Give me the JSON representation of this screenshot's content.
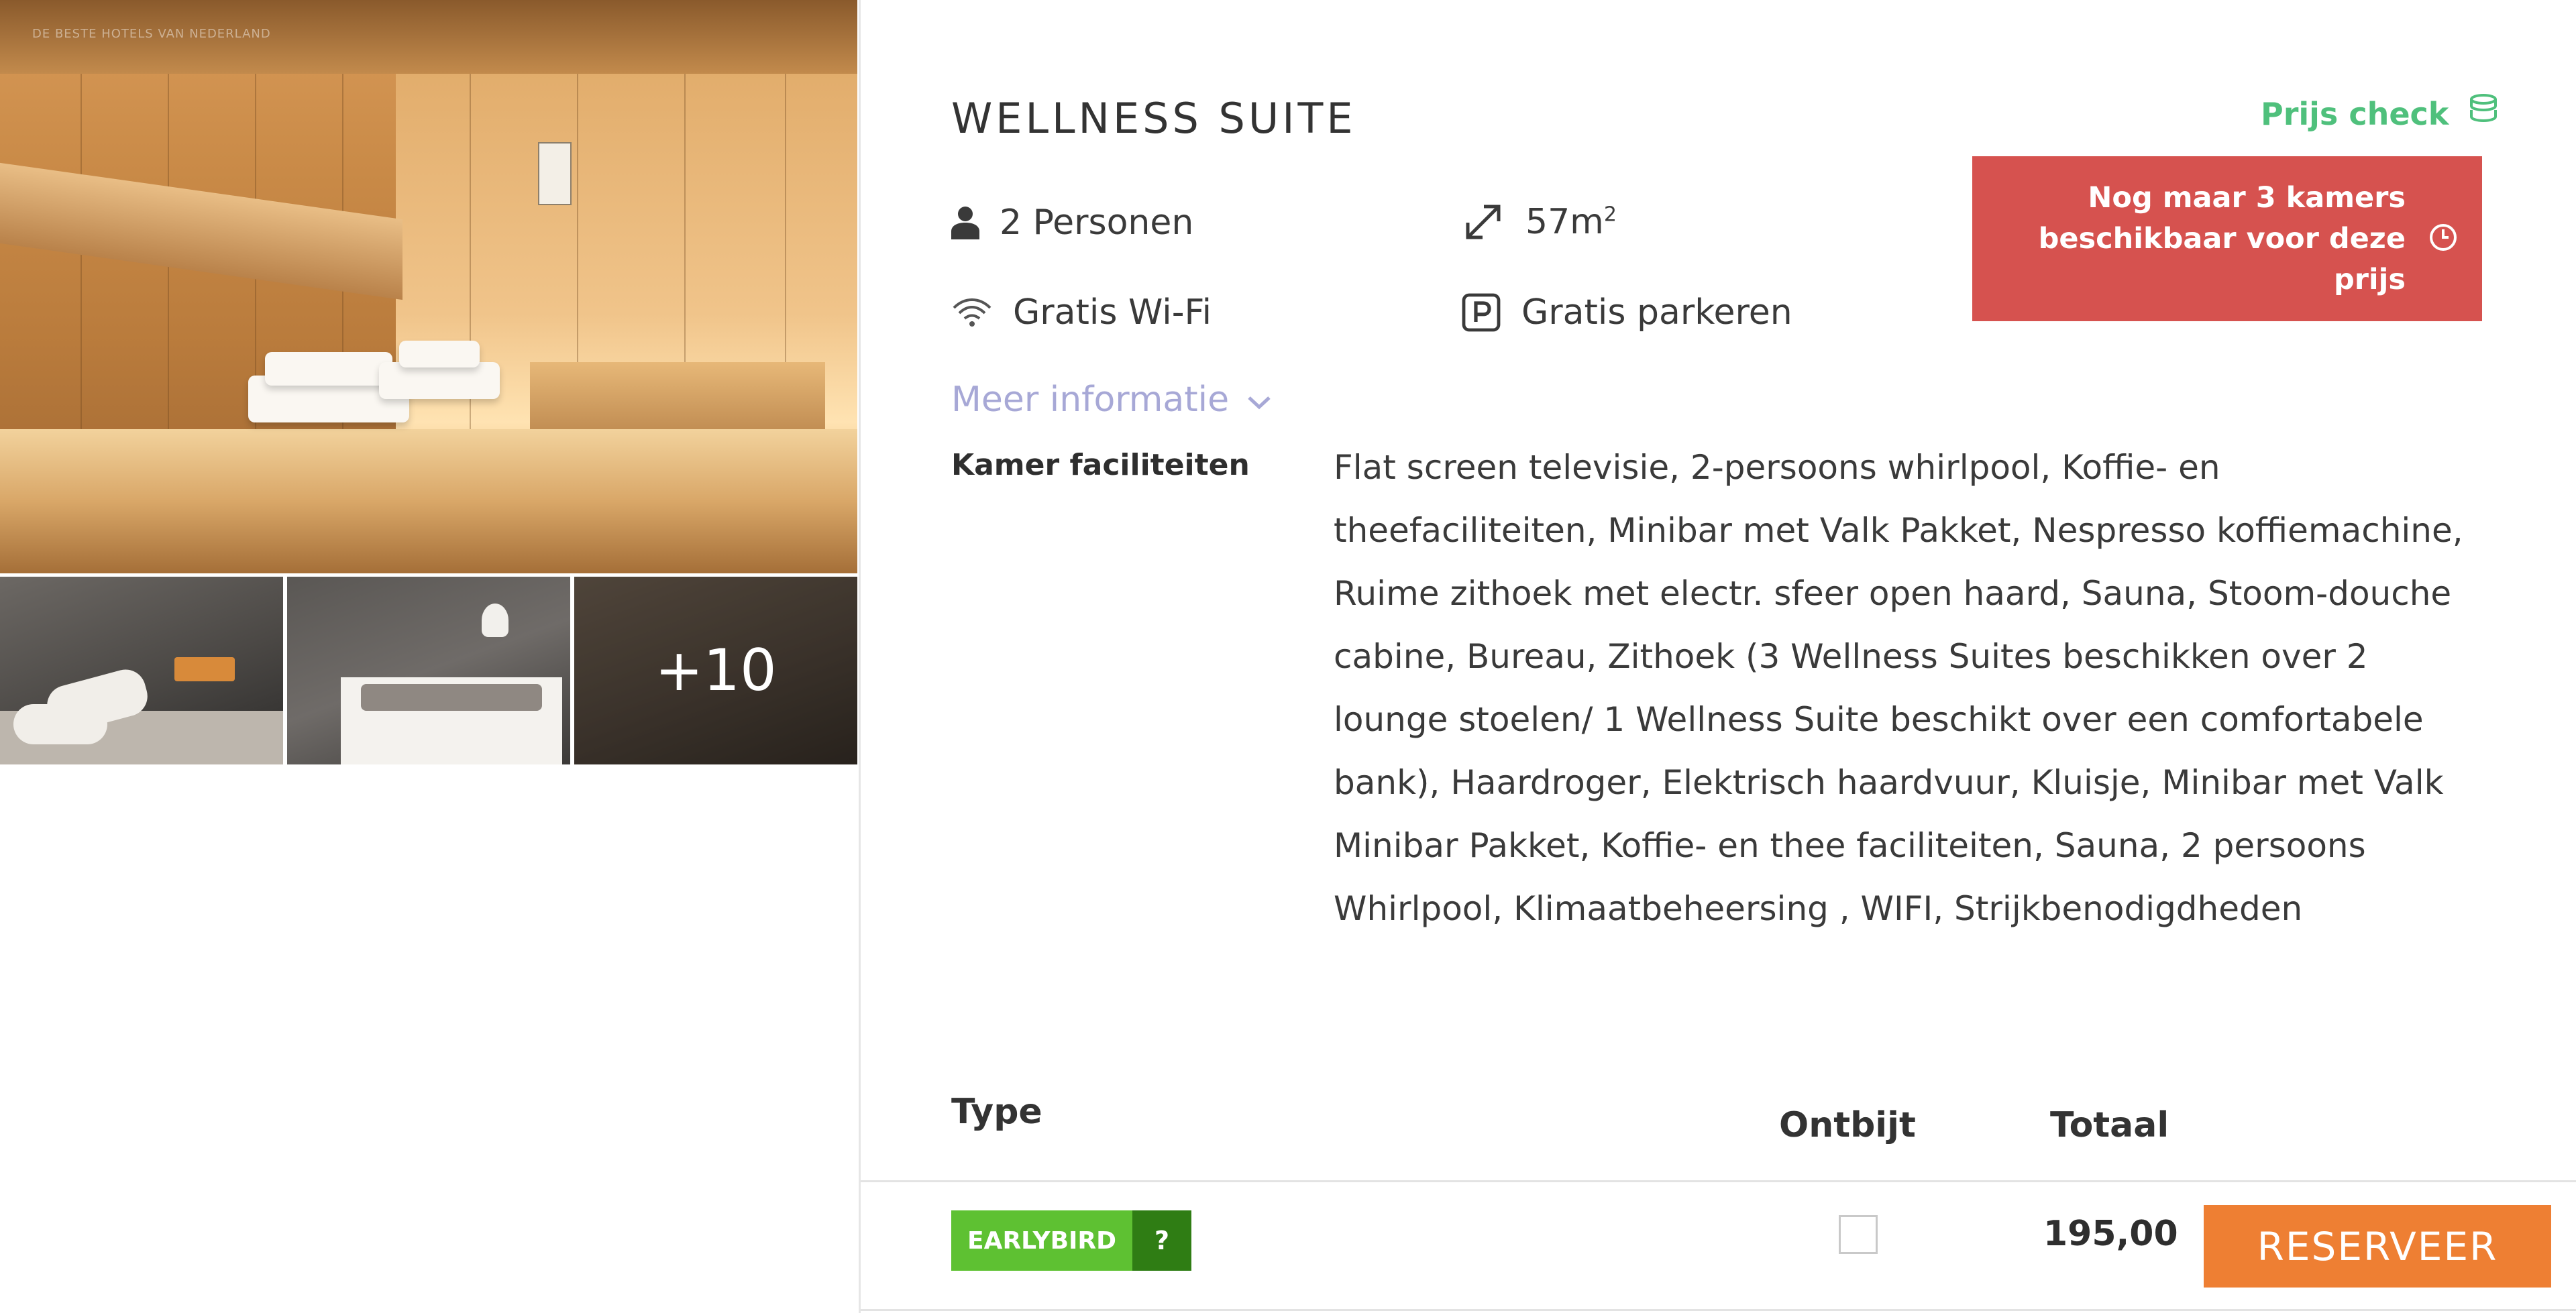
{
  "gallery": {
    "watermark": "DE BESTE HOTELS VAN NEDERLAND",
    "more_photos": "+10"
  },
  "room": {
    "title": "WELLNESS SUITE",
    "features": {
      "persons": "2 Personen",
      "size": "57m",
      "size_sup": "2",
      "wifi": "Gratis Wi-Fi",
      "parking": "Gratis parkeren"
    },
    "more_info": "Meer informatie",
    "facilities_label": "Kamer faciliteiten",
    "facilities_text": "Flat screen televisie, 2-persoons whirlpool, Koffie- en theefaciliteiten, Minibar met Valk Pakket, Nespresso koffiemachine, Ruime zithoek met electr. sfeer open haard, Sauna, Stoom-douche cabine, Bureau, Zithoek (3 Wellness Suites beschikken over 2 lounge stoelen/ 1 Wellness Suite beschikt over een comfortabele bank), Haardroger, Elektrisch haardvuur, Kluisje, Minibar met Valk Minibar Pakket, Koffie- en thee faciliteiten, Sauna, 2 persoons Whirlpool, Klimaatbeheersing , WIFI, Strijkbenodigdheden"
  },
  "price_check": {
    "label": "Prijs check",
    "icon": "piggy-bank-icon",
    "color": "#4fc07c"
  },
  "availability_alert": {
    "text": "Nog maar 3 kamers beschikbaar voor deze prijs",
    "icon": "clock-icon",
    "color": "#d6524f"
  },
  "rates_table": {
    "headers": {
      "type": "Type",
      "breakfast": "Ontbijt",
      "total": "Totaal"
    },
    "rows": [
      {
        "rate_name": "EARLYBIRD",
        "info": "?",
        "breakfast_checked": false,
        "total": "195,00",
        "action": "RESERVEER"
      }
    ]
  },
  "colors": {
    "rate_badge": "#5ec132",
    "rate_badge_info": "#2f7d14",
    "reserve_button": "#ee7f33",
    "more_info_link": "#a7a8d6"
  }
}
